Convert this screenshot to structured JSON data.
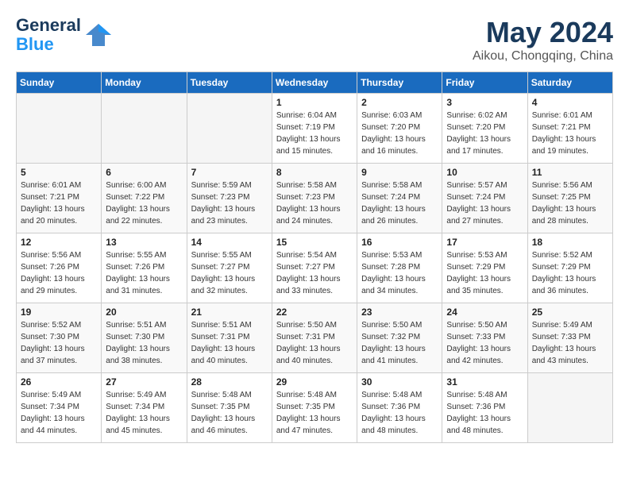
{
  "header": {
    "logo_general": "General",
    "logo_blue": "Blue",
    "month": "May 2024",
    "location": "Aikou, Chongqing, China"
  },
  "days_of_week": [
    "Sunday",
    "Monday",
    "Tuesday",
    "Wednesday",
    "Thursday",
    "Friday",
    "Saturday"
  ],
  "weeks": [
    [
      {
        "day": "",
        "empty": true
      },
      {
        "day": "",
        "empty": true
      },
      {
        "day": "",
        "empty": true
      },
      {
        "day": "1",
        "sunrise": "6:04 AM",
        "sunset": "7:19 PM",
        "daylight": "13 hours and 15 minutes."
      },
      {
        "day": "2",
        "sunrise": "6:03 AM",
        "sunset": "7:20 PM",
        "daylight": "13 hours and 16 minutes."
      },
      {
        "day": "3",
        "sunrise": "6:02 AM",
        "sunset": "7:20 PM",
        "daylight": "13 hours and 17 minutes."
      },
      {
        "day": "4",
        "sunrise": "6:01 AM",
        "sunset": "7:21 PM",
        "daylight": "13 hours and 19 minutes."
      }
    ],
    [
      {
        "day": "5",
        "sunrise": "6:01 AM",
        "sunset": "7:21 PM",
        "daylight": "13 hours and 20 minutes."
      },
      {
        "day": "6",
        "sunrise": "6:00 AM",
        "sunset": "7:22 PM",
        "daylight": "13 hours and 22 minutes."
      },
      {
        "day": "7",
        "sunrise": "5:59 AM",
        "sunset": "7:23 PM",
        "daylight": "13 hours and 23 minutes."
      },
      {
        "day": "8",
        "sunrise": "5:58 AM",
        "sunset": "7:23 PM",
        "daylight": "13 hours and 24 minutes."
      },
      {
        "day": "9",
        "sunrise": "5:58 AM",
        "sunset": "7:24 PM",
        "daylight": "13 hours and 26 minutes."
      },
      {
        "day": "10",
        "sunrise": "5:57 AM",
        "sunset": "7:24 PM",
        "daylight": "13 hours and 27 minutes."
      },
      {
        "day": "11",
        "sunrise": "5:56 AM",
        "sunset": "7:25 PM",
        "daylight": "13 hours and 28 minutes."
      }
    ],
    [
      {
        "day": "12",
        "sunrise": "5:56 AM",
        "sunset": "7:26 PM",
        "daylight": "13 hours and 29 minutes."
      },
      {
        "day": "13",
        "sunrise": "5:55 AM",
        "sunset": "7:26 PM",
        "daylight": "13 hours and 31 minutes."
      },
      {
        "day": "14",
        "sunrise": "5:55 AM",
        "sunset": "7:27 PM",
        "daylight": "13 hours and 32 minutes."
      },
      {
        "day": "15",
        "sunrise": "5:54 AM",
        "sunset": "7:27 PM",
        "daylight": "13 hours and 33 minutes."
      },
      {
        "day": "16",
        "sunrise": "5:53 AM",
        "sunset": "7:28 PM",
        "daylight": "13 hours and 34 minutes."
      },
      {
        "day": "17",
        "sunrise": "5:53 AM",
        "sunset": "7:29 PM",
        "daylight": "13 hours and 35 minutes."
      },
      {
        "day": "18",
        "sunrise": "5:52 AM",
        "sunset": "7:29 PM",
        "daylight": "13 hours and 36 minutes."
      }
    ],
    [
      {
        "day": "19",
        "sunrise": "5:52 AM",
        "sunset": "7:30 PM",
        "daylight": "13 hours and 37 minutes."
      },
      {
        "day": "20",
        "sunrise": "5:51 AM",
        "sunset": "7:30 PM",
        "daylight": "13 hours and 38 minutes."
      },
      {
        "day": "21",
        "sunrise": "5:51 AM",
        "sunset": "7:31 PM",
        "daylight": "13 hours and 40 minutes."
      },
      {
        "day": "22",
        "sunrise": "5:50 AM",
        "sunset": "7:31 PM",
        "daylight": "13 hours and 40 minutes."
      },
      {
        "day": "23",
        "sunrise": "5:50 AM",
        "sunset": "7:32 PM",
        "daylight": "13 hours and 41 minutes."
      },
      {
        "day": "24",
        "sunrise": "5:50 AM",
        "sunset": "7:33 PM",
        "daylight": "13 hours and 42 minutes."
      },
      {
        "day": "25",
        "sunrise": "5:49 AM",
        "sunset": "7:33 PM",
        "daylight": "13 hours and 43 minutes."
      }
    ],
    [
      {
        "day": "26",
        "sunrise": "5:49 AM",
        "sunset": "7:34 PM",
        "daylight": "13 hours and 44 minutes."
      },
      {
        "day": "27",
        "sunrise": "5:49 AM",
        "sunset": "7:34 PM",
        "daylight": "13 hours and 45 minutes."
      },
      {
        "day": "28",
        "sunrise": "5:48 AM",
        "sunset": "7:35 PM",
        "daylight": "13 hours and 46 minutes."
      },
      {
        "day": "29",
        "sunrise": "5:48 AM",
        "sunset": "7:35 PM",
        "daylight": "13 hours and 47 minutes."
      },
      {
        "day": "30",
        "sunrise": "5:48 AM",
        "sunset": "7:36 PM",
        "daylight": "13 hours and 48 minutes."
      },
      {
        "day": "31",
        "sunrise": "5:48 AM",
        "sunset": "7:36 PM",
        "daylight": "13 hours and 48 minutes."
      },
      {
        "day": "",
        "empty": true
      }
    ]
  ]
}
